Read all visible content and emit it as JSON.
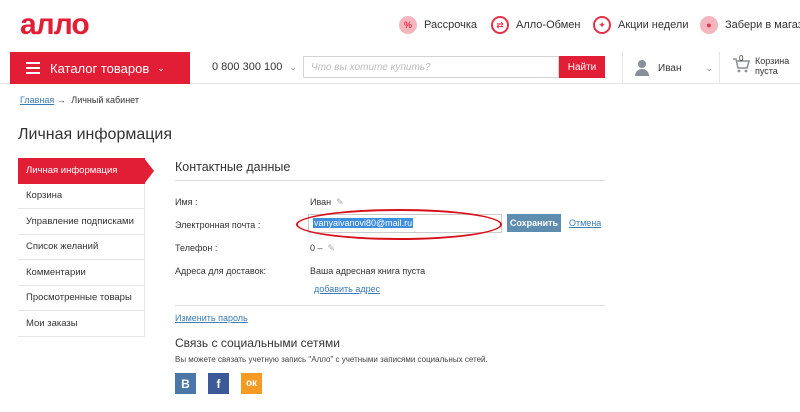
{
  "brand": {
    "logo": "алло",
    "accent": "#e21e36"
  },
  "topbar": {
    "promos": [
      {
        "label": "Рассрочка",
        "icon": "percent-icon"
      },
      {
        "label": "Алло-Обмен",
        "icon": "exchange-icon"
      },
      {
        "label": "Акции недели",
        "icon": "gift-icon"
      },
      {
        "label": "Забери в магазине",
        "icon": "location-pin-icon"
      }
    ]
  },
  "nav": {
    "catalog": "Каталог товаров",
    "phone": "0 800 300 100",
    "search_placeholder": "Что вы хотите купить?",
    "search_button": "Найти",
    "user": "Иван",
    "cart_count": "0",
    "cart_line1": "Корзина",
    "cart_line2": "пуста"
  },
  "breadcrumb": {
    "home": "Главная",
    "arrow": "→",
    "current": "Личный кабинет"
  },
  "page_title": "Личная информация",
  "sidebar": {
    "items": [
      {
        "label": "Личная информация",
        "active": true
      },
      {
        "label": "Корзина"
      },
      {
        "label": "Управление подписками"
      },
      {
        "label": "Список желаний"
      },
      {
        "label": "Комментарии"
      },
      {
        "label": "Просмотренные товары"
      },
      {
        "label": "Мои заказы"
      }
    ]
  },
  "contacts": {
    "title": "Контактные данные",
    "name_label": "Имя :",
    "name_value": "Иван",
    "email_label": "Электронная почта :",
    "email_value": "vanyaivanovi80@mail.ru",
    "save_button": "Сохранить",
    "cancel_link": "Отмена",
    "phone_label": "Телефон :",
    "phone_value": "0 –",
    "address_label": "Адреса для доставок:",
    "address_value": "Ваша адресная книга пуста",
    "add_address": "добавить адрес",
    "change_password": "Изменить пароль"
  },
  "social": {
    "title": "Связь с социальными сетями",
    "description": "Вы можете связать учетную запись \"Алло\" с учетными записями социальных сетей.",
    "networks": [
      {
        "label": "В",
        "color": "#4a76a8"
      },
      {
        "label": "f",
        "color": "#3b5998"
      },
      {
        "label": "ок",
        "color": "#f59a23"
      }
    ]
  }
}
